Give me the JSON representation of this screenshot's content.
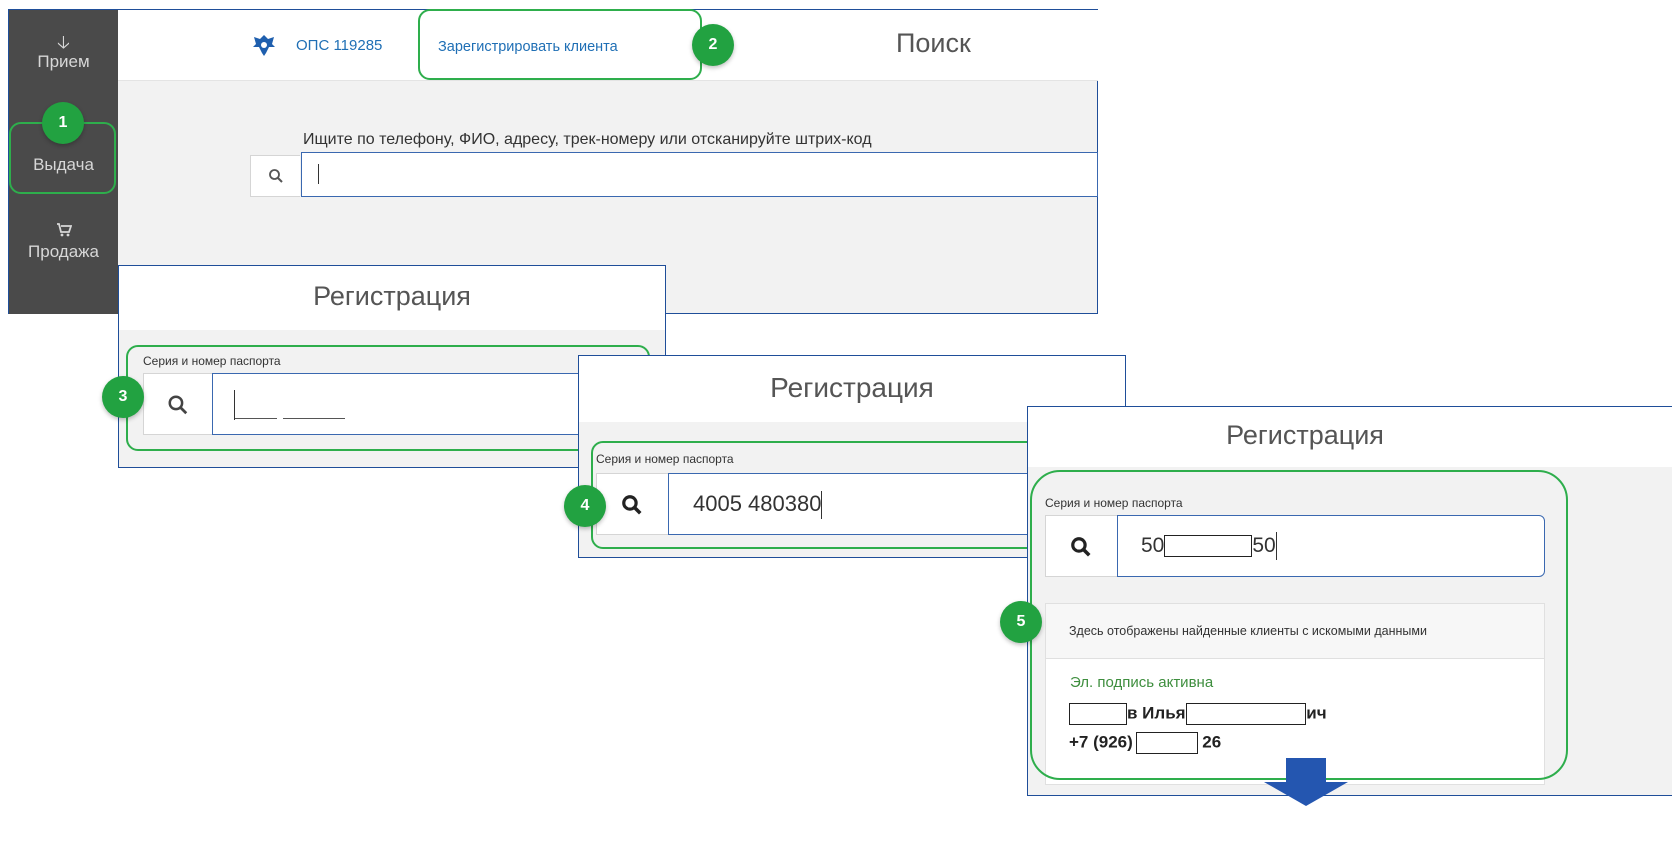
{
  "colors": {
    "accent_green": "#22a241",
    "highlight_green": "#2eae4c",
    "sidebar_bg": "#4a4a4a",
    "link_blue": "#1f6fb5",
    "border_blue": "#1f4e99",
    "signature_green": "#3e8e3e"
  },
  "sidebar": {
    "items": [
      {
        "label": "Прием",
        "icon": "arrow-down-icon"
      },
      {
        "label": "Выдача",
        "icon": ""
      },
      {
        "label": "Продажа",
        "icon": "cart-icon"
      }
    ]
  },
  "header": {
    "logo_icon": "eagle-emblem-icon",
    "office": "ОПС 119285",
    "register_link": "Зарегистрировать клиента",
    "title": "Поиск"
  },
  "search": {
    "hint": "Ищите по телефону, ФИО, адресу, трек-номеру или отсканируйте штрих-код",
    "value": ""
  },
  "registration": {
    "title": "Регистрация",
    "passport_label": "Серия и номер паспорта",
    "step3_value": "",
    "step4_value": "4005 480380",
    "step5_prefix": "50",
    "step5_suffix": "50",
    "results_header": "Здесь отображены найденные клиенты с искомыми данными",
    "client": {
      "signature_status": "Эл. подпись активна",
      "name_part1": "в Илья",
      "name_part2": "ич",
      "phone_prefix": "+7 (926)",
      "phone_suffix": "26"
    }
  },
  "badges": [
    "1",
    "2",
    "3",
    "4",
    "5"
  ]
}
